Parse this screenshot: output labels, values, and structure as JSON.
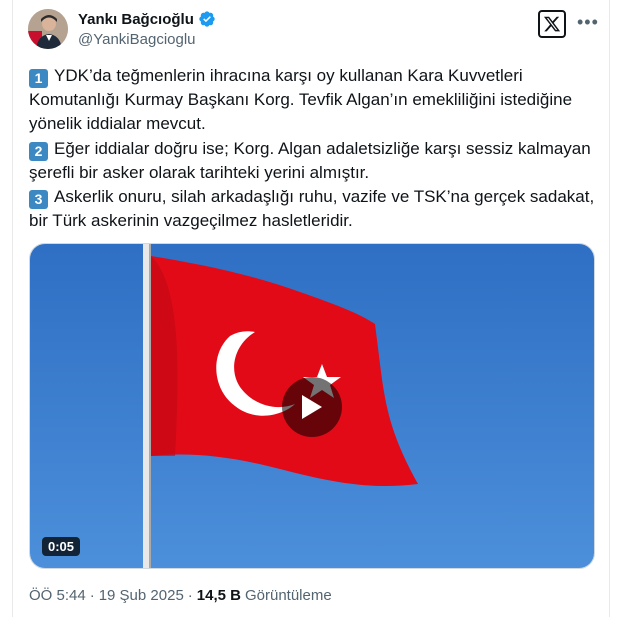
{
  "author": {
    "name": "Yankı Bağcıoğlu",
    "handle": "@YankiBagcioglu"
  },
  "tweet": {
    "paragraphs": [
      {
        "number": "1",
        "text": "YDK’da teğmenlerin ihracına karşı oy kullanan Kara Kuvvetleri Komutanlığı  Kurmay Başkanı Korg. Tevfik Algan’ın emekliliğini istediğine yönelik iddialar mevcut."
      },
      {
        "number": "2",
        "text": "Eğer iddialar doğru ise; Korg. Algan adaletsizliğe karşı  sessiz kalmayan şerefli bir asker olarak tarihteki yerini almıştır."
      },
      {
        "number": "3",
        "text": "Askerlik onuru, silah arkadaşlığı ruhu, vazife ve TSK’na gerçek sadakat, bir Türk askerinin vazgeçilmez hasletleridir."
      }
    ]
  },
  "media": {
    "duration": "0:05"
  },
  "meta": {
    "time": "ÖÖ 5:44",
    "separator": "·",
    "date": "19 Şub 2025",
    "views_count": "14,5 B",
    "views_label": "Görüntüleme"
  },
  "colors": {
    "accent": "#1d9bf0",
    "keycap": "#3b88c3",
    "flag_red": "#e30a17",
    "sky": "#3a7fd0"
  }
}
